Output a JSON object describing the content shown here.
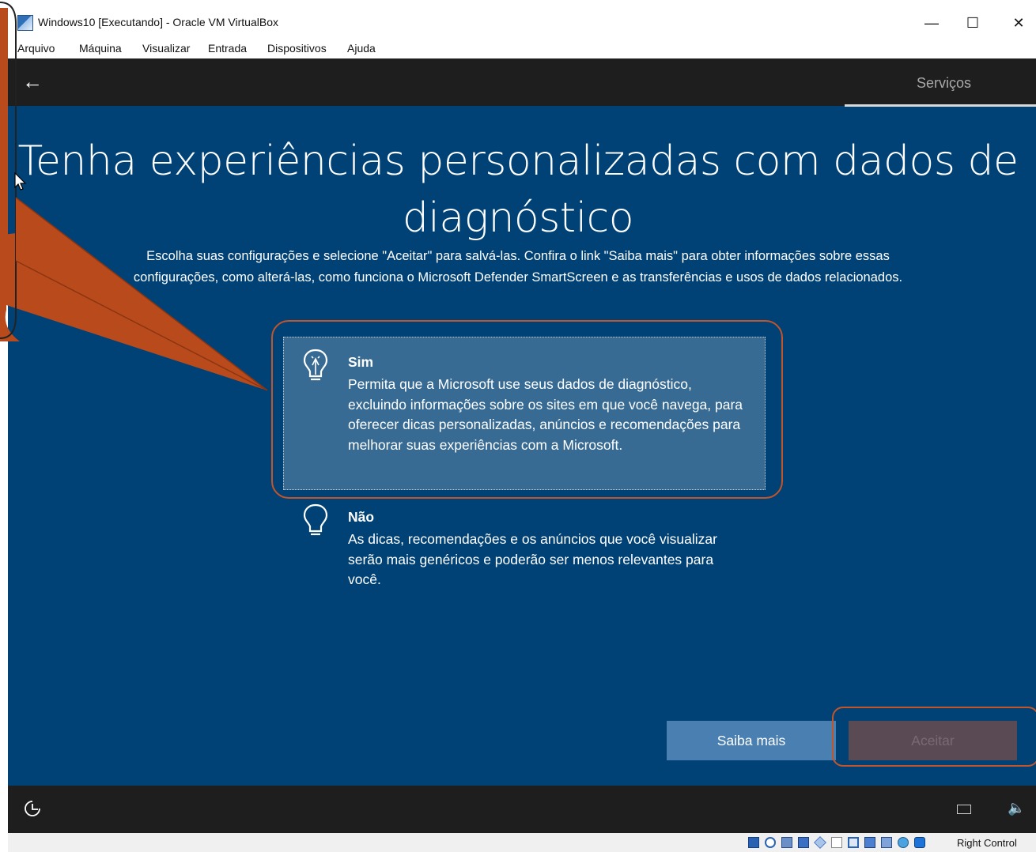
{
  "window": {
    "title": "Windows10 [Executando] - Oracle VM VirtualBox",
    "controls": {
      "minimize": "—",
      "maximize": "☐",
      "close": "✕"
    }
  },
  "menubar": {
    "items": [
      "Arquivo",
      "Máquina",
      "Visualizar",
      "Entrada",
      "Dispositivos",
      "Ajuda"
    ]
  },
  "oobe": {
    "back_icon": "←",
    "section_tab": "Serviços",
    "headline_line1": "Tenha experiências personalizadas com dados de",
    "headline_line2": "diagnóstico",
    "description_line1": "Escolha suas configurações e selecione \"Aceitar\" para salvá-las. Confira o link \"Saiba mais\" para obter informações sobre essas",
    "description_line2": "configurações, como alterá-las, como funciona o Microsoft Defender SmartScreen e as transferências e usos de dados relacionados.",
    "options": [
      {
        "icon": "lightbulb-on-icon",
        "title": "Sim",
        "description": "Permita que a Microsoft use seus dados de diagnóstico, excluindo informações sobre os sites em que você navega, para oferecer dicas personalizadas, anúncios e recomendações para melhorar suas experiências com a Microsoft.",
        "selected": true
      },
      {
        "icon": "lightbulb-off-icon",
        "title": "Não",
        "description": "As dicas, recomendações e os anúncios que você visualizar serão mais genéricos e poderão ser menos relevantes para você.",
        "selected": false
      }
    ],
    "learn_more_label": "Saiba mais",
    "accept_label": "Aceitar",
    "accessibility_icon": "ease-of-access-icon",
    "volume_icon": "🔈"
  },
  "statusbar": {
    "host_key": "Right Control",
    "icons": [
      "hard-disk-icon",
      "optical-drive-icon",
      "audio-icon",
      "network-icon",
      "usb-icon",
      "shared-folder-icon",
      "display-icon",
      "recording-icon",
      "cpu-icon",
      "mouse-integration-icon",
      "keyboard-capture-icon"
    ]
  },
  "colors": {
    "oobe_background": "#004275",
    "topbar_background": "#1e1e1e",
    "learn_more_button": "#4a7fb1",
    "callout_fill": "#b94a1c",
    "callout_border": "#c2552a"
  }
}
